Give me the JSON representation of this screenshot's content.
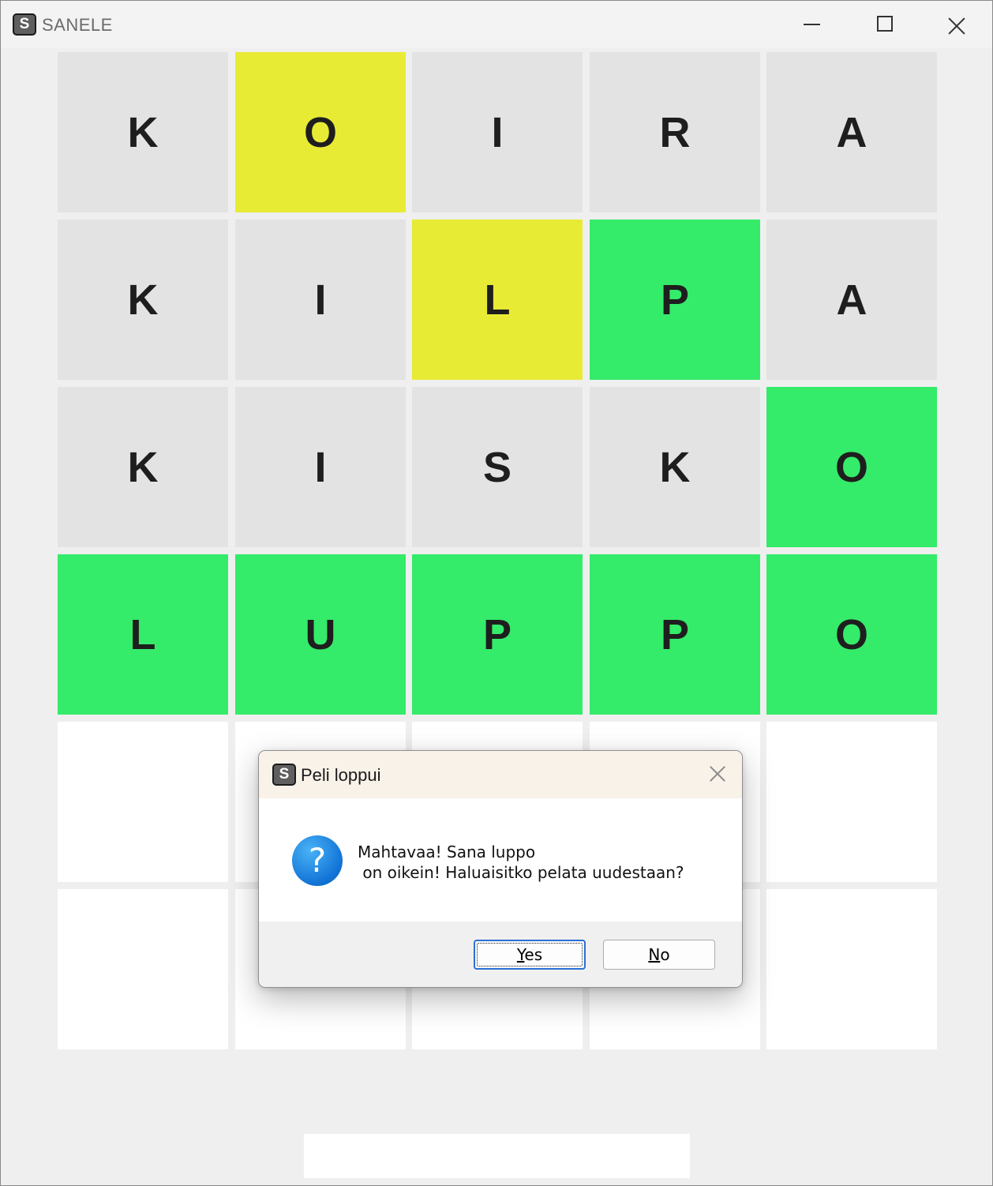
{
  "window": {
    "icon_letter": "S",
    "title": "SANELE"
  },
  "board": {
    "colors": {
      "gray": "#e3e3e3",
      "yellow": "#e8eb34",
      "green": "#35eb6a",
      "empty": "#ffffff"
    },
    "rows": [
      [
        {
          "letter": "K",
          "state": "gray"
        },
        {
          "letter": "O",
          "state": "yellow"
        },
        {
          "letter": "I",
          "state": "gray"
        },
        {
          "letter": "R",
          "state": "gray"
        },
        {
          "letter": "A",
          "state": "gray"
        }
      ],
      [
        {
          "letter": "K",
          "state": "gray"
        },
        {
          "letter": "I",
          "state": "gray"
        },
        {
          "letter": "L",
          "state": "yellow"
        },
        {
          "letter": "P",
          "state": "green"
        },
        {
          "letter": "A",
          "state": "gray"
        }
      ],
      [
        {
          "letter": "K",
          "state": "gray"
        },
        {
          "letter": "I",
          "state": "gray"
        },
        {
          "letter": "S",
          "state": "gray"
        },
        {
          "letter": "K",
          "state": "gray"
        },
        {
          "letter": "O",
          "state": "green"
        }
      ],
      [
        {
          "letter": "L",
          "state": "green"
        },
        {
          "letter": "U",
          "state": "green"
        },
        {
          "letter": "P",
          "state": "green"
        },
        {
          "letter": "P",
          "state": "green"
        },
        {
          "letter": "O",
          "state": "green"
        }
      ],
      [
        {
          "letter": "",
          "state": "empty"
        },
        {
          "letter": "",
          "state": "empty"
        },
        {
          "letter": "",
          "state": "empty"
        },
        {
          "letter": "",
          "state": "empty"
        },
        {
          "letter": "",
          "state": "empty"
        }
      ],
      [
        {
          "letter": "",
          "state": "empty"
        },
        {
          "letter": "",
          "state": "empty"
        },
        {
          "letter": "",
          "state": "empty"
        },
        {
          "letter": "",
          "state": "empty"
        },
        {
          "letter": "",
          "state": "empty"
        }
      ]
    ]
  },
  "dialog": {
    "icon_letter": "S",
    "title": "Peli loppui",
    "message": "Mahtavaa! Sana luppo\n on oikein! Haluaisitko pelata uudestaan?",
    "question_icon": "?",
    "yes_mnemonic": "Y",
    "yes_rest": "es",
    "no_mnemonic": "N",
    "no_rest": "o"
  }
}
